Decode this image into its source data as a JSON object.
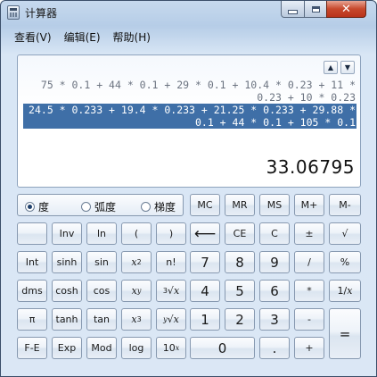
{
  "window": {
    "title": "计算器"
  },
  "menu": [
    "查看(V)",
    "编辑(E)",
    "帮助(H)"
  ],
  "display": {
    "history": [
      {
        "line1": "75 * 0.1 + 44 * 0.1 + 29 * 0.1 + 10.4 * 0.23 + 11 *",
        "line2": "0.23 + 10 * 0.23"
      },
      {
        "line1": "24.5 * 0.233 + 19.4 * 0.233 + 21.25 * 0.233 + 29.88 *",
        "line2": "0.1 + 44 * 0.1 + 105 * 0.1"
      }
    ],
    "value": "33.06795"
  },
  "angle_modes": {
    "options": [
      "度",
      "弧度",
      "梯度"
    ],
    "selected": "度"
  },
  "buttons": {
    "mc": "MC",
    "mr": "MR",
    "ms": "MS",
    "mplus": "M+",
    "mminus": "M-",
    "inv": "Inv",
    "ln": "ln",
    "lparen": "(",
    "rparen": ")",
    "backspace": "⟵",
    "ce": "CE",
    "c": "C",
    "plusminus": "±",
    "sqrt": "√",
    "int": "Int",
    "sinh": "sinh",
    "sin": "sin",
    "x": "x",
    "sq": "2",
    "nfact": "n!",
    "d7": "7",
    "d8": "8",
    "d9": "9",
    "divide": "/",
    "percent": "%",
    "dms": "dms",
    "cosh": "cosh",
    "cos": "cos",
    "y": "y",
    "root3": "3",
    "root_y": "y",
    "d4": "4",
    "d5": "5",
    "d6": "6",
    "multiply": "*",
    "recip_num": "1/",
    "recip_x": "x",
    "pi": "π",
    "tanh": "tanh",
    "tan": "tan",
    "cube": "3",
    "root_x_index": "x",
    "d1": "1",
    "d2": "2",
    "d3": "3",
    "minus": "-",
    "equals": "=",
    "fe": "F-E",
    "exp": "Exp",
    "mod": "Mod",
    "log": "log",
    "ten": "10",
    "ten_exp": "x",
    "d0": "0",
    "dot": ".",
    "plus": "+"
  },
  "icons": {
    "app": "calculator-icon",
    "minimize": "minimize-icon",
    "maximize": "maximize-icon",
    "close": "close-icon",
    "history_up": "triangle-up-icon",
    "history_down": "triangle-down-icon"
  }
}
